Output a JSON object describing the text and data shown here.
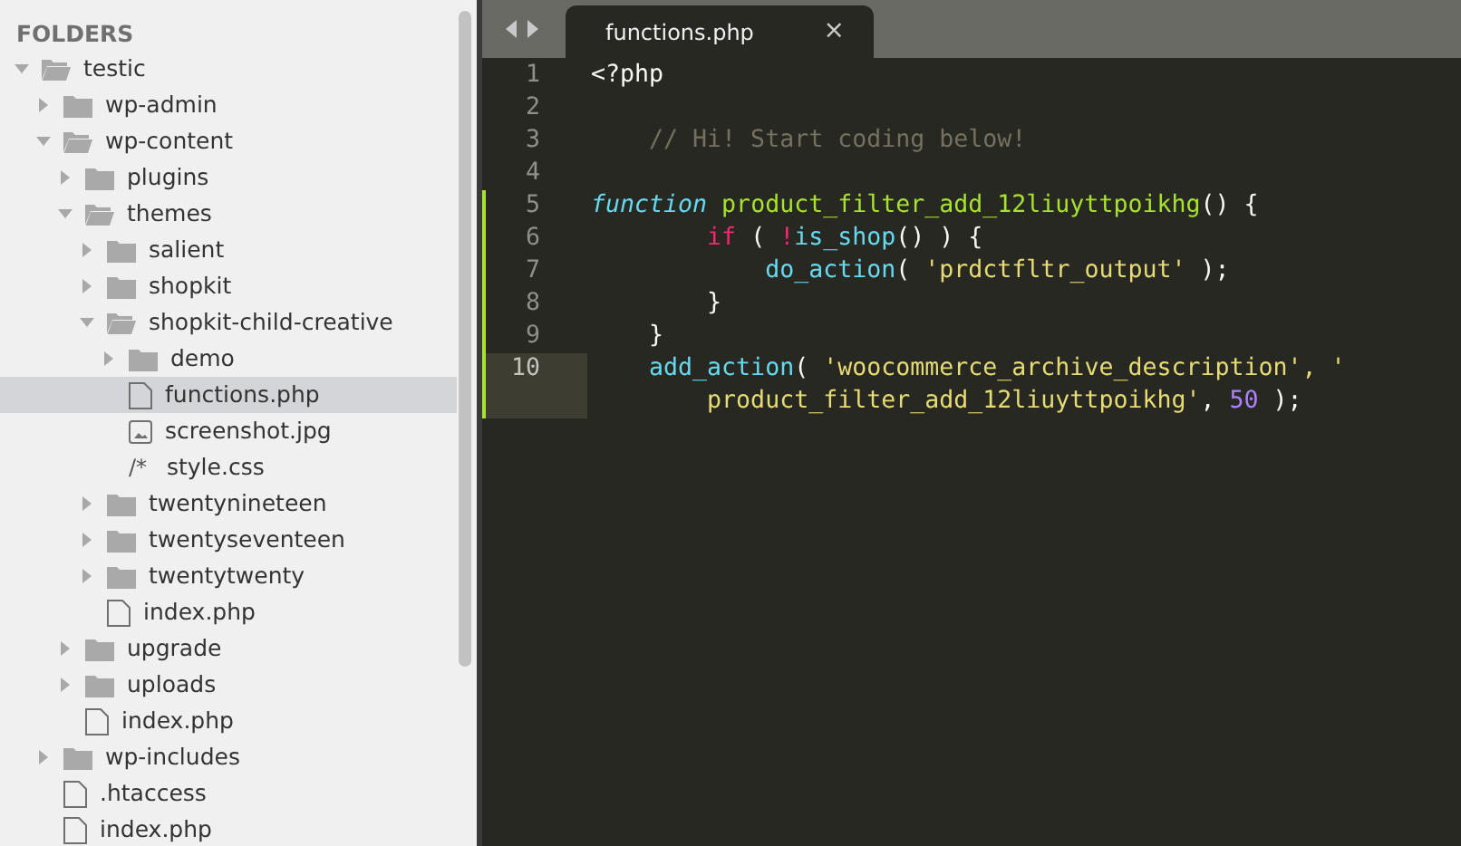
{
  "sidebar": {
    "title": "FOLDERS",
    "tree": [
      {
        "name": "testic",
        "kind": "folder",
        "expanded": true,
        "selected": false,
        "children": [
          {
            "name": "wp-admin",
            "kind": "folder",
            "expanded": false,
            "selected": false
          },
          {
            "name": "wp-content",
            "kind": "folder",
            "expanded": true,
            "selected": false,
            "children": [
              {
                "name": "plugins",
                "kind": "folder",
                "expanded": false,
                "selected": false
              },
              {
                "name": "themes",
                "kind": "folder",
                "expanded": true,
                "selected": false,
                "children": [
                  {
                    "name": "salient",
                    "kind": "folder",
                    "expanded": false,
                    "selected": false
                  },
                  {
                    "name": "shopkit",
                    "kind": "folder",
                    "expanded": false,
                    "selected": false
                  },
                  {
                    "name": "shopkit-child-creative",
                    "kind": "folder",
                    "expanded": true,
                    "selected": false,
                    "children": [
                      {
                        "name": "demo",
                        "kind": "folder",
                        "expanded": false,
                        "selected": false
                      },
                      {
                        "name": "functions.php",
                        "kind": "file",
                        "selected": true
                      },
                      {
                        "name": "screenshot.jpg",
                        "kind": "image",
                        "selected": false
                      },
                      {
                        "name": "style.css",
                        "kind": "code",
                        "glyph": "/*",
                        "selected": false
                      }
                    ]
                  },
                  {
                    "name": "twentynineteen",
                    "kind": "folder",
                    "expanded": false,
                    "selected": false
                  },
                  {
                    "name": "twentyseventeen",
                    "kind": "folder",
                    "expanded": false,
                    "selected": false
                  },
                  {
                    "name": "twentytwenty",
                    "kind": "folder",
                    "expanded": false,
                    "selected": false
                  },
                  {
                    "name": "index.php",
                    "kind": "file",
                    "selected": false
                  }
                ]
              },
              {
                "name": "upgrade",
                "kind": "folder",
                "expanded": false,
                "selected": false
              },
              {
                "name": "uploads",
                "kind": "folder",
                "expanded": false,
                "selected": false
              },
              {
                "name": "index.php",
                "kind": "file",
                "selected": false
              }
            ]
          },
          {
            "name": "wp-includes",
            "kind": "folder",
            "expanded": false,
            "selected": false
          },
          {
            "name": ".htaccess",
            "kind": "file",
            "selected": false
          },
          {
            "name": "index.php",
            "kind": "file",
            "selected": false
          }
        ]
      }
    ]
  },
  "tabs": [
    {
      "label": "functions.php",
      "close": "×",
      "selected": true
    }
  ],
  "editor": {
    "lines": [
      {
        "number": "1",
        "modified": false,
        "current": false,
        "tokens": [
          {
            "text": "<?php",
            "kind": "plain"
          }
        ]
      },
      {
        "number": "2",
        "modified": false,
        "current": false
      },
      {
        "number": "3",
        "modified": false,
        "current": false,
        "tokens": [
          {
            "text": "    // Hi! Start coding below!",
            "kind": "comment"
          }
        ]
      },
      {
        "number": "4",
        "modified": false,
        "current": false
      },
      {
        "number": "5",
        "modified": true,
        "current": false,
        "tokens": [
          {
            "text": "function",
            "kind": "storage"
          },
          {
            "text": " product_filter_add_12liuyttpoikhg",
            "kind": "entity"
          },
          {
            "text": "() {",
            "kind": "plain"
          }
        ]
      },
      {
        "number": "6",
        "modified": true,
        "current": false,
        "tokens": [
          {
            "text": "        if",
            "kind": "keyword"
          },
          {
            "text": " ( ",
            "kind": "plain"
          },
          {
            "text": "!",
            "kind": "keyword"
          },
          {
            "text": "is_shop",
            "kind": "support"
          },
          {
            "text": "() ) {",
            "kind": "plain"
          }
        ]
      },
      {
        "number": "7",
        "modified": true,
        "current": false,
        "tokens": [
          {
            "text": "            do_action",
            "kind": "support"
          },
          {
            "text": "( ",
            "kind": "plain"
          },
          {
            "text": "'prdctfltr_output'",
            "kind": "string"
          },
          {
            "text": " );",
            "kind": "plain"
          }
        ]
      },
      {
        "number": "8",
        "modified": true,
        "current": false,
        "tokens": [
          {
            "text": "        }",
            "kind": "plain"
          }
        ]
      },
      {
        "number": "9",
        "modified": true,
        "current": false,
        "tokens": [
          {
            "text": "    }",
            "kind": "plain"
          }
        ]
      },
      {
        "number": "10",
        "modified": true,
        "current": true,
        "tokens": [
          {
            "text": "    add_action",
            "kind": "support"
          },
          {
            "text": "( ",
            "kind": "plain"
          },
          {
            "text": "'woocommerce_archive_description', '",
            "kind": "string"
          }
        ]
      },
      {
        "modified": true,
        "current": true,
        "tokens": [
          {
            "text": "        product_filter_add_12liuyttpoikhg'",
            "kind": "string"
          },
          {
            "text": ", ",
            "kind": "plain"
          },
          {
            "text": "50",
            "kind": "number"
          },
          {
            "text": " );",
            "kind": "plain"
          }
        ]
      }
    ]
  }
}
